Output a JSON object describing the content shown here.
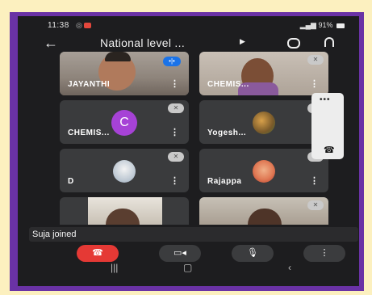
{
  "status_bar": {
    "time": "11:38",
    "right_text": "91%"
  },
  "meeting": {
    "title": "National level ..."
  },
  "participants": [
    {
      "name": "JAYANTHI",
      "talking": true
    },
    {
      "name": "CHEMIS...",
      "muted": true
    },
    {
      "name": "CHEMIS...",
      "avatar_letter": "C",
      "muted": true
    },
    {
      "name": "Yogesh...",
      "muted": true
    },
    {
      "name": "D",
      "muted": true
    },
    {
      "name": "Rajappa",
      "muted": true
    },
    {
      "name": ""
    },
    {
      "name": "",
      "muted": true
    }
  ],
  "toast": {
    "text": "Suja joined"
  },
  "colors": {
    "frame": "#6a32a5",
    "background": "#fcf0bf",
    "end_call": "#e53935",
    "avatar": "#a642d6",
    "speaking": "#1a73e8"
  }
}
